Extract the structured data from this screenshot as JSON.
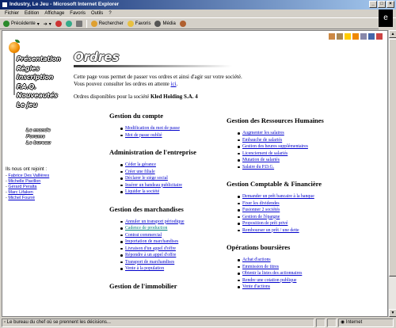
{
  "window": {
    "title": "Industry, Le Jeu - Microsoft Internet Explorer"
  },
  "menu": [
    "Fichier",
    "Edition",
    "Affichage",
    "Favoris",
    "Outils",
    "?"
  ],
  "toolbar": {
    "back": "Précédente",
    "search": "Rechercher",
    "favorites": "Favoris",
    "media": "Média"
  },
  "nav": {
    "items": [
      "Présentation",
      "Règles",
      "Inscription",
      "F.A.Q.",
      "Nouveautés",
      "Le jeu"
    ],
    "sub": [
      "Le monde",
      "Forums",
      "Le bureau"
    ]
  },
  "joined": {
    "header": "Ils nous ont rejoint :",
    "people": [
      "Fabrice Des Vallières",
      "Michelle Pavillon",
      "Gérard Peralta",
      "Marc Lifaken",
      "Michel Fourré"
    ]
  },
  "page": {
    "title": "Ordres",
    "intro1": "Cette page vous permet de passer vos ordres et ainsi d'agir sur votre société.",
    "intro2_prefix": "Vous pouvez consulter les ordres en attente ",
    "intro2_link": "ici",
    "intro2_suffix": ".",
    "company_prefix": "Ordres disponibles pour la société ",
    "company_name": "Kled Holding S.A. 4"
  },
  "sections_left": [
    {
      "title": "Gestion du compte",
      "items": [
        "Modification du mot de passe",
        "Mot de passe oublié"
      ]
    },
    {
      "title": "Administration de l'entreprise",
      "items": [
        "Céder la gérance",
        "Créer une filiale",
        "Déclarer le siège social",
        "Insérer un bandeau publicitaire",
        "Liquider la société"
      ]
    },
    {
      "title": "Gestion des marchandises",
      "items": [
        "Annuler un transport périodique",
        "Cadence de production",
        "Contrat commercial",
        "Importation de marchandises",
        "Livraison d'un appel d'offre",
        "Répondre à un appel d'offre",
        "Transport de marchandises",
        "Vente à la population"
      ]
    },
    {
      "title": "Gestion de l'immobilier",
      "items": []
    }
  ],
  "sections_right": [
    {
      "title": "Gestion des Ressources Humaines",
      "items": [
        "Augmenter les salaires",
        "Embauche de salariés",
        "Gestion des heures supplémentaires",
        "Licenciement de salariés",
        "Mutation de salariés",
        "Salaire du P.D.G."
      ]
    },
    {
      "title": "Gestion Comptable & Financière",
      "items": [
        "Demander un prêt bancaire à la banque",
        "Fixer les dividendes",
        "Fusionner 2 sociétés",
        "Gestion de l'épargne",
        "Proposition de prêt privé",
        "Rembourser un prêt / une dette"
      ]
    },
    {
      "title": "Opérations boursières",
      "items": [
        "Achat d'actions",
        "Emmission de titres",
        "Obtenir la listes des actionnaires",
        "Rendre une cotation publique",
        "Vente d'actions"
      ]
    }
  ],
  "status": {
    "text": "Le bureau du chef où se prennent les décisions...",
    "zone": "Internet"
  }
}
